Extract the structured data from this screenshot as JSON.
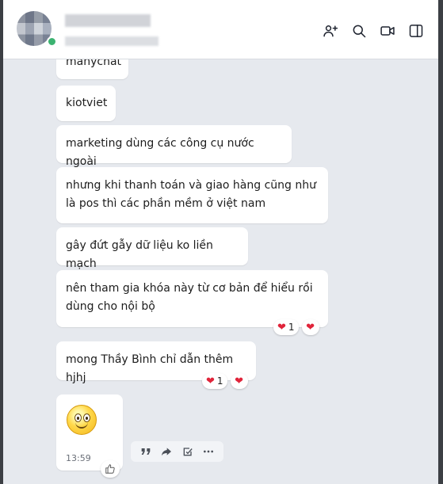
{
  "header": {
    "contact_name": "████████",
    "contact_status": "████████ ██",
    "icons": [
      "add-member-icon",
      "search-icon",
      "video-call-icon",
      "sidebar-toggle-icon"
    ]
  },
  "messages": [
    {
      "text": "manychat"
    },
    {
      "text": "kiotviet"
    },
    {
      "text": "marketing dùng các công cụ nước ngoài"
    },
    {
      "text": "nhưng khi thanh toán và giao hàng cũng như là pos thì các phần mềm ở việt nam"
    },
    {
      "text": "gây đứt gẫy dữ liệu ko liền mạch"
    },
    {
      "text": "nên tham gia khóa này từ cơ bản để hiểu rồi dùng cho nội bộ",
      "reaction_count": "1"
    },
    {
      "text": "mong Thầy Bình chỉ dẫn thêm hjhj",
      "reaction_count": "1"
    },
    {
      "sticker": "smiley",
      "time": "13:59"
    }
  ],
  "hover_toolbar": [
    "quote-icon",
    "forward-icon",
    "task-icon",
    "more-icon"
  ],
  "colors": {
    "background": "#e6e9ee",
    "bubble": "#ffffff",
    "heart": "#e0243a"
  }
}
